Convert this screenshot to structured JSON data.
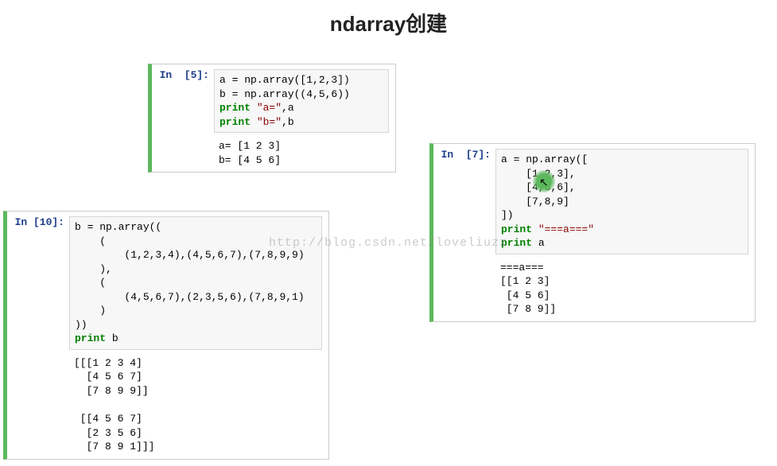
{
  "title": "ndarray创建",
  "watermark": "http://blog.csdn.net/loveliuzz",
  "cells": {
    "c5": {
      "prompt": "In  [5]:",
      "code_lines": [
        [
          {
            "t": "txt",
            "v": "a = np.array([1,2,3])"
          }
        ],
        [
          {
            "t": "txt",
            "v": "b = np.array((4,5,6))"
          }
        ],
        [
          {
            "t": "kw",
            "v": "print "
          },
          {
            "t": "str",
            "v": "\"a=\""
          },
          {
            "t": "txt",
            "v": ",a"
          }
        ],
        [
          {
            "t": "kw",
            "v": "print "
          },
          {
            "t": "str",
            "v": "\"b=\""
          },
          {
            "t": "txt",
            "v": ",b"
          }
        ]
      ],
      "output": "a= [1 2 3]\nb= [4 5 6]"
    },
    "c7": {
      "prompt": "In  [7]:",
      "code_lines": [
        [
          {
            "t": "txt",
            "v": "a = np.array(["
          }
        ],
        [
          {
            "t": "txt",
            "v": "    [1,2,3],"
          }
        ],
        [
          {
            "t": "txt",
            "v": "    [4,5,6],"
          }
        ],
        [
          {
            "t": "txt",
            "v": "    [7,8,9]"
          }
        ],
        [
          {
            "t": "txt",
            "v": "])"
          }
        ],
        [
          {
            "t": "kw",
            "v": "print "
          },
          {
            "t": "str",
            "v": "\"===a===\""
          }
        ],
        [
          {
            "t": "kw",
            "v": "print "
          },
          {
            "t": "txt",
            "v": "a"
          }
        ]
      ],
      "output": "===a===\n[[1 2 3]\n [4 5 6]\n [7 8 9]]"
    },
    "c10": {
      "prompt": "In [10]:",
      "code_lines": [
        [
          {
            "t": "txt",
            "v": "b = np.array(("
          }
        ],
        [
          {
            "t": "txt",
            "v": "    ("
          }
        ],
        [
          {
            "t": "txt",
            "v": "        (1,2,3,4),(4,5,6,7),(7,8,9,9)"
          }
        ],
        [
          {
            "t": "txt",
            "v": "    ),"
          }
        ],
        [
          {
            "t": "txt",
            "v": "    ("
          }
        ],
        [
          {
            "t": "txt",
            "v": "        (4,5,6,7),(2,3,5,6),(7,8,9,1)"
          }
        ],
        [
          {
            "t": "txt",
            "v": "    )"
          }
        ],
        [
          {
            "t": "txt",
            "v": "))"
          }
        ],
        [
          {
            "t": "kw",
            "v": "print "
          },
          {
            "t": "txt",
            "v": "b"
          }
        ]
      ],
      "output": "[[[1 2 3 4]\n  [4 5 6 7]\n  [7 8 9 9]]\n\n [[4 5 6 7]\n  [2 3 5 6]\n  [7 8 9 1]]]"
    }
  }
}
